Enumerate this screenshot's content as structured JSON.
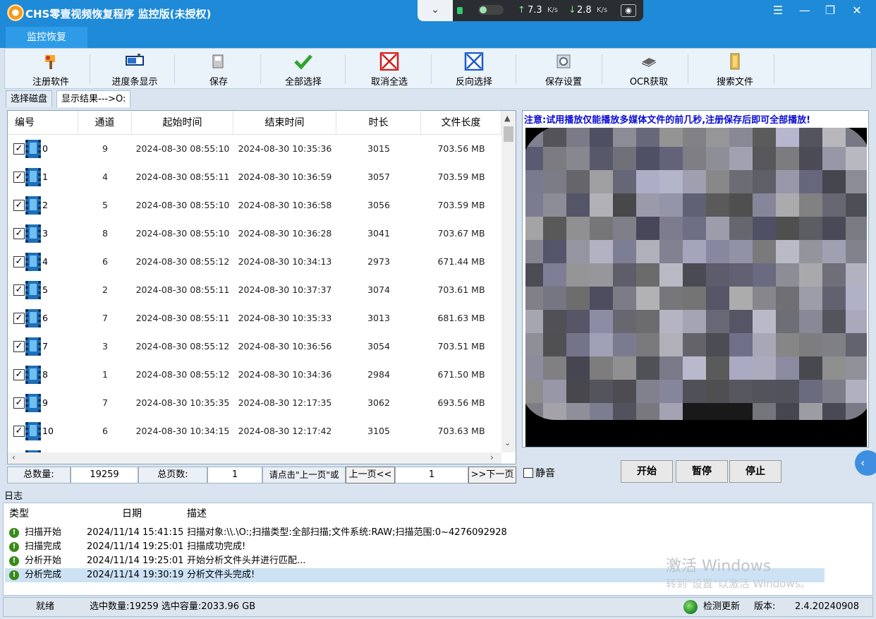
{
  "window": {
    "title": "CHS零壹视频恢复程序 监控版(未授权)"
  },
  "network": {
    "upload": "7.3",
    "download": "2.8",
    "unit": "K/s"
  },
  "main_tab": "监控恢复",
  "toolbar": [
    {
      "label": "注册软件",
      "icon": "register-icon"
    },
    {
      "label": "进度条显示",
      "icon": "progress-icon"
    },
    {
      "label": "保存",
      "icon": "save-icon"
    },
    {
      "label": "全部选择",
      "icon": "select-all-icon"
    },
    {
      "label": "取消全选",
      "icon": "deselect-all-icon"
    },
    {
      "label": "反向选择",
      "icon": "invert-selection-icon"
    },
    {
      "label": "保存设置",
      "icon": "save-settings-icon"
    },
    {
      "label": "OCR获取",
      "icon": "ocr-icon"
    },
    {
      "label": "搜索文件",
      "icon": "search-file-icon"
    }
  ],
  "subtabs": [
    "选择磁盘",
    "显示结果--->O:"
  ],
  "grid": {
    "columns": [
      "编号",
      "通道",
      "起始时间",
      "结束时间",
      "时长",
      "文件长度"
    ],
    "rows": [
      {
        "id": "0",
        "channel": "9",
        "start": "2024-08-30 08:55:10",
        "end": "2024-08-30 10:35:36",
        "duration": "3015",
        "size": "703.56 MB"
      },
      {
        "id": "1",
        "channel": "4",
        "start": "2024-08-30 08:55:11",
        "end": "2024-08-30 10:36:59",
        "duration": "3057",
        "size": "703.59 MB"
      },
      {
        "id": "2",
        "channel": "5",
        "start": "2024-08-30 08:55:10",
        "end": "2024-08-30 10:36:58",
        "duration": "3056",
        "size": "703.59 MB"
      },
      {
        "id": "3",
        "channel": "8",
        "start": "2024-08-30 08:55:10",
        "end": "2024-08-30 10:36:28",
        "duration": "3041",
        "size": "703.67 MB"
      },
      {
        "id": "4",
        "channel": "6",
        "start": "2024-08-30 08:55:12",
        "end": "2024-08-30 10:34:13",
        "duration": "2973",
        "size": "671.44 MB"
      },
      {
        "id": "5",
        "channel": "2",
        "start": "2024-08-30 08:55:11",
        "end": "2024-08-30 10:37:37",
        "duration": "3074",
        "size": "703.61 MB"
      },
      {
        "id": "6",
        "channel": "7",
        "start": "2024-08-30 08:55:11",
        "end": "2024-08-30 10:35:33",
        "duration": "3013",
        "size": "681.63 MB"
      },
      {
        "id": "7",
        "channel": "3",
        "start": "2024-08-30 08:55:12",
        "end": "2024-08-30 10:36:56",
        "duration": "3054",
        "size": "703.51 MB"
      },
      {
        "id": "8",
        "channel": "1",
        "start": "2024-08-30 08:55:12",
        "end": "2024-08-30 10:34:36",
        "duration": "2984",
        "size": "671.50 MB"
      },
      {
        "id": "9",
        "channel": "7",
        "start": "2024-08-30 10:35:35",
        "end": "2024-08-30 12:17:35",
        "duration": "3062",
        "size": "693.56 MB"
      },
      {
        "id": "10",
        "channel": "6",
        "start": "2024-08-30 10:34:15",
        "end": "2024-08-30 12:17:42",
        "duration": "3105",
        "size": "703.63 MB"
      }
    ]
  },
  "pager": {
    "total_label": "总数量:",
    "total": "19259",
    "pages_label": "总页数:",
    "pages": "1",
    "hint": "请点击\"上一页\"或",
    "prev": "上一页<<",
    "current": "1",
    "next": ">>下一页"
  },
  "preview": {
    "notice": "注意:试用播放仅能播放多媒体文件的前几秒,注册保存后即可全部播放!"
  },
  "player": {
    "mute": "静音",
    "play": "开始",
    "pause": "暂停",
    "stop": "停止"
  },
  "log": {
    "title": "日志",
    "columns": [
      "类型",
      "日期",
      "描述"
    ],
    "rows": [
      {
        "type": "扫描开始",
        "date": "2024/11/14 15:41:15",
        "desc": "扫描对象:\\\\.\\O:;扫描类型:全部扫描;文件系统:RAW;扫描范围:0~4276092928"
      },
      {
        "type": "扫描完成",
        "date": "2024/11/14 19:25:01",
        "desc": "扫描成功完成!"
      },
      {
        "type": "分析开始",
        "date": "2024/11/14 19:25:01",
        "desc": "开始分析文件头并进行匹配..."
      },
      {
        "type": "分析完成",
        "date": "2024/11/14 19:30:19",
        "desc": "分析文件头完成!"
      }
    ]
  },
  "watermark": {
    "line1": "激活 Windows",
    "line2": "转到\"设置\"以激活 Windows。"
  },
  "status": {
    "ready": "就绪",
    "selection": "选中数量:19259 选中容量:2033.96 GB",
    "update": "检测更新",
    "version_label": "版本:",
    "version": "2.4.20240908"
  }
}
